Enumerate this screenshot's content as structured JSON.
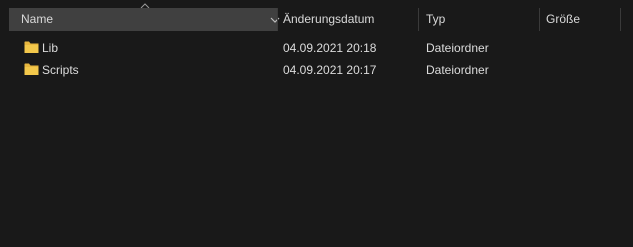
{
  "columns": {
    "name": "Name",
    "date": "Änderungsdatum",
    "type": "Typ",
    "size": "Größe"
  },
  "sort": {
    "column": "name",
    "direction": "ascending"
  },
  "files": [
    {
      "name": "Lib",
      "date": "04.09.2021 20:18",
      "type": "Dateiordner",
      "icon": "folder-icon"
    },
    {
      "name": "Scripts",
      "date": "04.09.2021 20:17",
      "type": "Dateiordner",
      "icon": "folder-icon"
    }
  ],
  "colors": {
    "background": "#191919",
    "header_active": "#404040",
    "folder": "#f3c84b"
  }
}
